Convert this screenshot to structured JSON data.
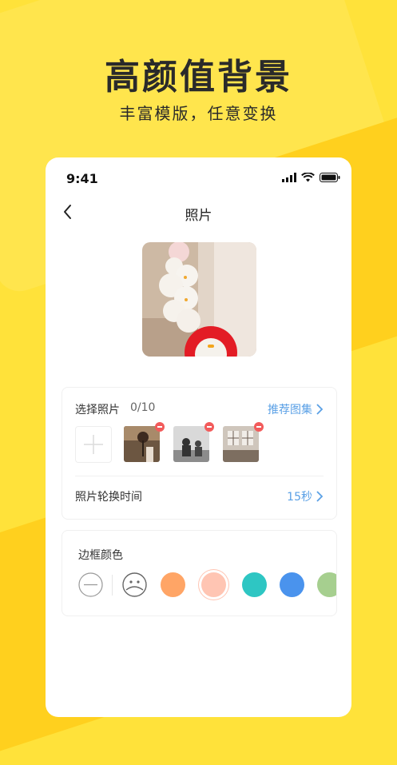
{
  "promo": {
    "headline": "高颜值背景",
    "subline": "丰富模版，任意变换"
  },
  "status_bar": {
    "time": "9:41",
    "icons": [
      "signal-icon",
      "wifi-icon",
      "battery-icon"
    ]
  },
  "nav": {
    "title": "照片",
    "back_icon": "chevron-left-icon"
  },
  "photos": {
    "label": "选择照片",
    "count": "0/10",
    "recommend_link": "推荐图集",
    "add_icon": "plus-icon",
    "thumbnails": [
      "flower-photo",
      "people-photo",
      "room-photo"
    ]
  },
  "interval": {
    "label": "照片轮换时间",
    "value": "15秒"
  },
  "border_color": {
    "label": "边框颜色",
    "options": [
      {
        "name": "none",
        "color": "#ffffff"
      },
      {
        "name": "custom",
        "color": "#ffffff"
      },
      {
        "name": "orange",
        "color": "#ffa566"
      },
      {
        "name": "peach",
        "color": "#ffc5b3"
      },
      {
        "name": "teal",
        "color": "#2ec6c3"
      },
      {
        "name": "blue",
        "color": "#4a93ed"
      },
      {
        "name": "green",
        "color": "#a6cf8f"
      }
    ],
    "selected": "peach"
  },
  "colors": {
    "background": "#ffe23a",
    "accent_link": "#5aa0e6",
    "delete_badge": "#f25b5b"
  }
}
